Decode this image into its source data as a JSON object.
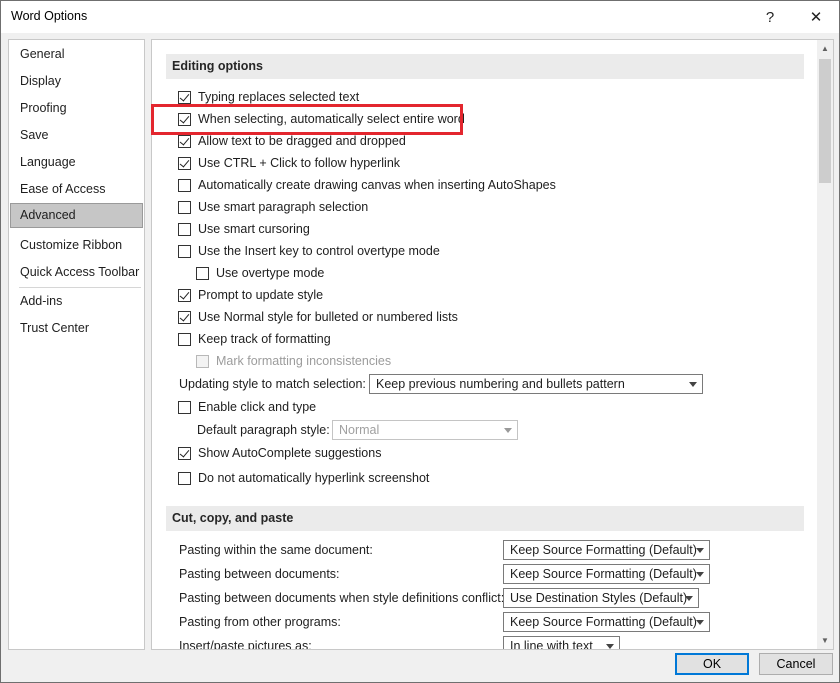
{
  "window": {
    "title": "Word Options",
    "help_glyph": "?",
    "close_glyph": "✕"
  },
  "nav": {
    "items": [
      "General",
      "Display",
      "Proofing",
      "Save",
      "Language",
      "Ease of Access",
      "Advanced",
      "Customize Ribbon",
      "Quick Access Toolbar",
      "Add-ins",
      "Trust Center"
    ],
    "selected": "Advanced"
  },
  "editing": {
    "header": "Editing options",
    "options": [
      {
        "label": "Typing replaces selected text",
        "checked": true,
        "enabled": true
      },
      {
        "label": "When selecting, automatically select entire word",
        "checked": true,
        "enabled": true
      },
      {
        "label": "Allow text to be dragged and dropped",
        "checked": true,
        "enabled": true
      },
      {
        "label": "Use CTRL + Click to follow hyperlink",
        "checked": true,
        "enabled": true
      },
      {
        "label": "Automatically create drawing canvas when inserting AutoShapes",
        "checked": false,
        "enabled": true
      },
      {
        "label": "Use smart paragraph selection",
        "checked": false,
        "enabled": true
      },
      {
        "label": "Use smart cursoring",
        "checked": false,
        "enabled": true
      },
      {
        "label": "Use the Insert key to control overtype mode",
        "checked": false,
        "enabled": true
      },
      {
        "label": "Use overtype mode",
        "checked": false,
        "enabled": true
      },
      {
        "label": "Prompt to update style",
        "checked": true,
        "enabled": true
      },
      {
        "label": "Use Normal style for bulleted or numbered lists",
        "checked": true,
        "enabled": true
      },
      {
        "label": "Keep track of formatting",
        "checked": false,
        "enabled": true
      },
      {
        "label": "Mark formatting inconsistencies",
        "checked": false,
        "enabled": false
      }
    ],
    "updating_style_label": "Updating style to match selection:",
    "updating_style_value": "Keep previous numbering and bullets pattern",
    "click_and_type": {
      "label": "Enable click and type",
      "checked": false
    },
    "default_paragraph_label": "Default paragraph style:",
    "default_paragraph_value": "Normal",
    "autocomplete": {
      "label": "Show AutoComplete suggestions",
      "checked": true
    },
    "no_hyperlink_screenshot": {
      "label": "Do not automatically hyperlink screenshot",
      "checked": false
    }
  },
  "paste": {
    "header": "Cut, copy, and paste",
    "rows": [
      {
        "label": "Pasting within the same document:",
        "value": "Keep Source Formatting (Default)"
      },
      {
        "label": "Pasting between documents:",
        "value": "Keep Source Formatting (Default)"
      },
      {
        "label": "Pasting between documents when style definitions conflict:",
        "value": "Use Destination Styles (Default)"
      },
      {
        "label": "Pasting from other programs:",
        "value": "Keep Source Formatting (Default)"
      },
      {
        "label": "Insert/paste pictures as:",
        "value": "In line with text"
      }
    ]
  },
  "buttons": {
    "ok": "OK",
    "cancel": "Cancel"
  },
  "colors": {
    "highlight": "#e3262e",
    "ok_border": "#0078d7"
  }
}
